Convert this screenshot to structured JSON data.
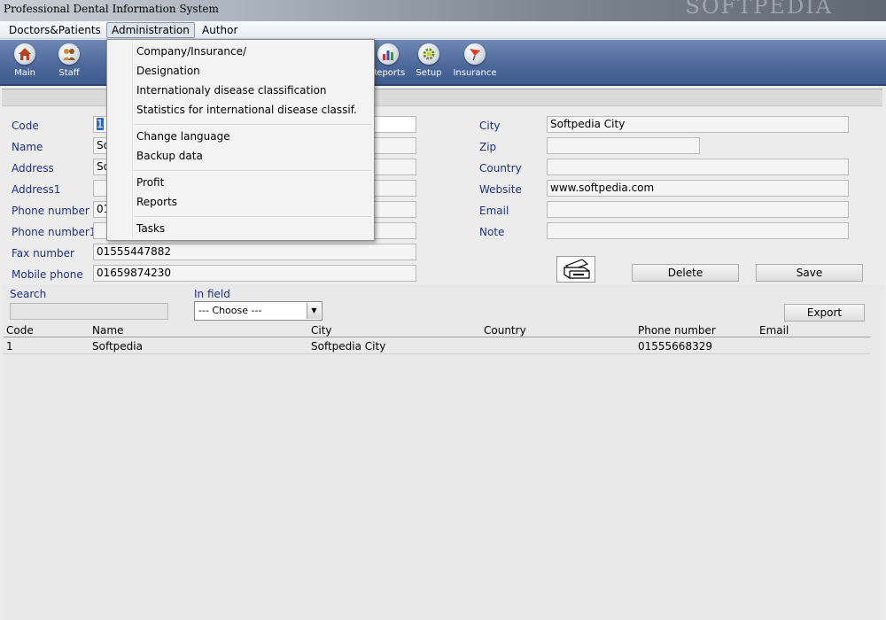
{
  "window": {
    "title": "Professional Dental Information System",
    "watermark": "SOFTPEDIA"
  },
  "menubar": {
    "items": [
      "Doctors&Patients",
      "Administration",
      "Author"
    ]
  },
  "toolbar": {
    "buttons": [
      "Main",
      "Staff",
      "Reports",
      "Setup",
      "Insurance"
    ]
  },
  "form": {
    "labels": {
      "code": "Code",
      "name": "Name",
      "address": "Address",
      "address1": "Address1",
      "phone": "Phone number",
      "phone1": "Phone number1",
      "fax": "Fax number",
      "mobile": "Mobile phone",
      "city": "City",
      "zip": "Zip",
      "country": "Country",
      "website": "Website",
      "email": "Email",
      "note": "Note"
    },
    "values": {
      "code": "1",
      "name_partial": "So",
      "address_partial": "So",
      "phone_partial": "01",
      "fax": "01555447882",
      "mobile": "01659874230",
      "city": "Softpedia City",
      "zip": "",
      "country": "",
      "website": "www.softpedia.com",
      "email": "",
      "note": ""
    },
    "buttons": {
      "delete": "Delete",
      "save": "Save"
    }
  },
  "search": {
    "label": "Search",
    "value": "",
    "infield_label": "In field",
    "infield_value": "--- Choose ---",
    "export": "Export"
  },
  "grid": {
    "headers": [
      "Code",
      "Name",
      "City",
      "Country",
      "Phone number",
      "Email"
    ],
    "rows": [
      [
        "1",
        "Softpedia",
        "Softpedia City",
        "",
        "01555668329",
        ""
      ]
    ]
  },
  "admin_menu": {
    "items": [
      "Company/Insurance/",
      "Designation",
      "Internationaly disease classification",
      "Statistics for international disease classif.",
      "Change language",
      "Backup data",
      "Profit",
      "Reports",
      "Tasks"
    ]
  },
  "colors": {
    "label": "#1f2f86",
    "toolbar": "#4e6a9c",
    "selection": "#316ac5"
  },
  "icons": [
    "house-icon",
    "staff-icon",
    "reports-chart-icon",
    "setup-gear-icon",
    "insurance-flag-icon",
    "printer-icon",
    "dropdown-arrow-icon"
  ]
}
